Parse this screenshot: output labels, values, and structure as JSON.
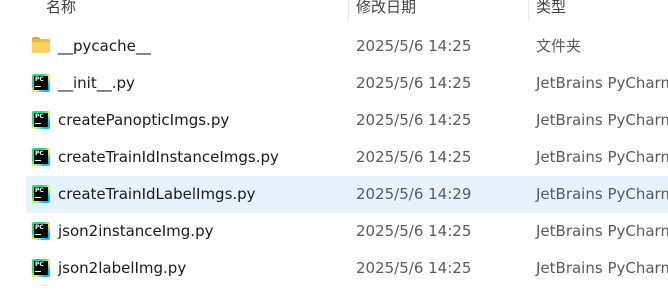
{
  "header": {
    "name_label": "名称",
    "date_label": "修改日期",
    "type_label": "类型"
  },
  "files": [
    {
      "name": "__pycache__",
      "date": "2025/5/6 14:25",
      "type": "文件夹",
      "icon": "folder-icon",
      "selected": false
    },
    {
      "name": "__init__.py",
      "date": "2025/5/6 14:25",
      "type": "JetBrains PyCharm",
      "icon": "pycharm-file-icon",
      "selected": false
    },
    {
      "name": "createPanopticImgs.py",
      "date": "2025/5/6 14:25",
      "type": "JetBrains PyCharm",
      "icon": "pycharm-file-icon",
      "selected": false
    },
    {
      "name": "createTrainIdInstanceImgs.py",
      "date": "2025/5/6 14:25",
      "type": "JetBrains PyCharm",
      "icon": "pycharm-file-icon",
      "selected": false
    },
    {
      "name": "createTrainIdLabelImgs.py",
      "date": "2025/5/6 14:29",
      "type": "JetBrains PyCharm",
      "icon": "pycharm-file-icon",
      "selected": true
    },
    {
      "name": "json2instanceImg.py",
      "date": "2025/5/6 14:25",
      "type": "JetBrains PyCharm",
      "icon": "pycharm-file-icon",
      "selected": false
    },
    {
      "name": "json2labelImg.py",
      "date": "2025/5/6 14:25",
      "type": "JetBrains PyCharm",
      "icon": "pycharm-file-icon",
      "selected": false
    }
  ],
  "icon_text": "PC",
  "colors": {
    "selection": "#e5f3ff",
    "folder": "#f8d35e"
  }
}
